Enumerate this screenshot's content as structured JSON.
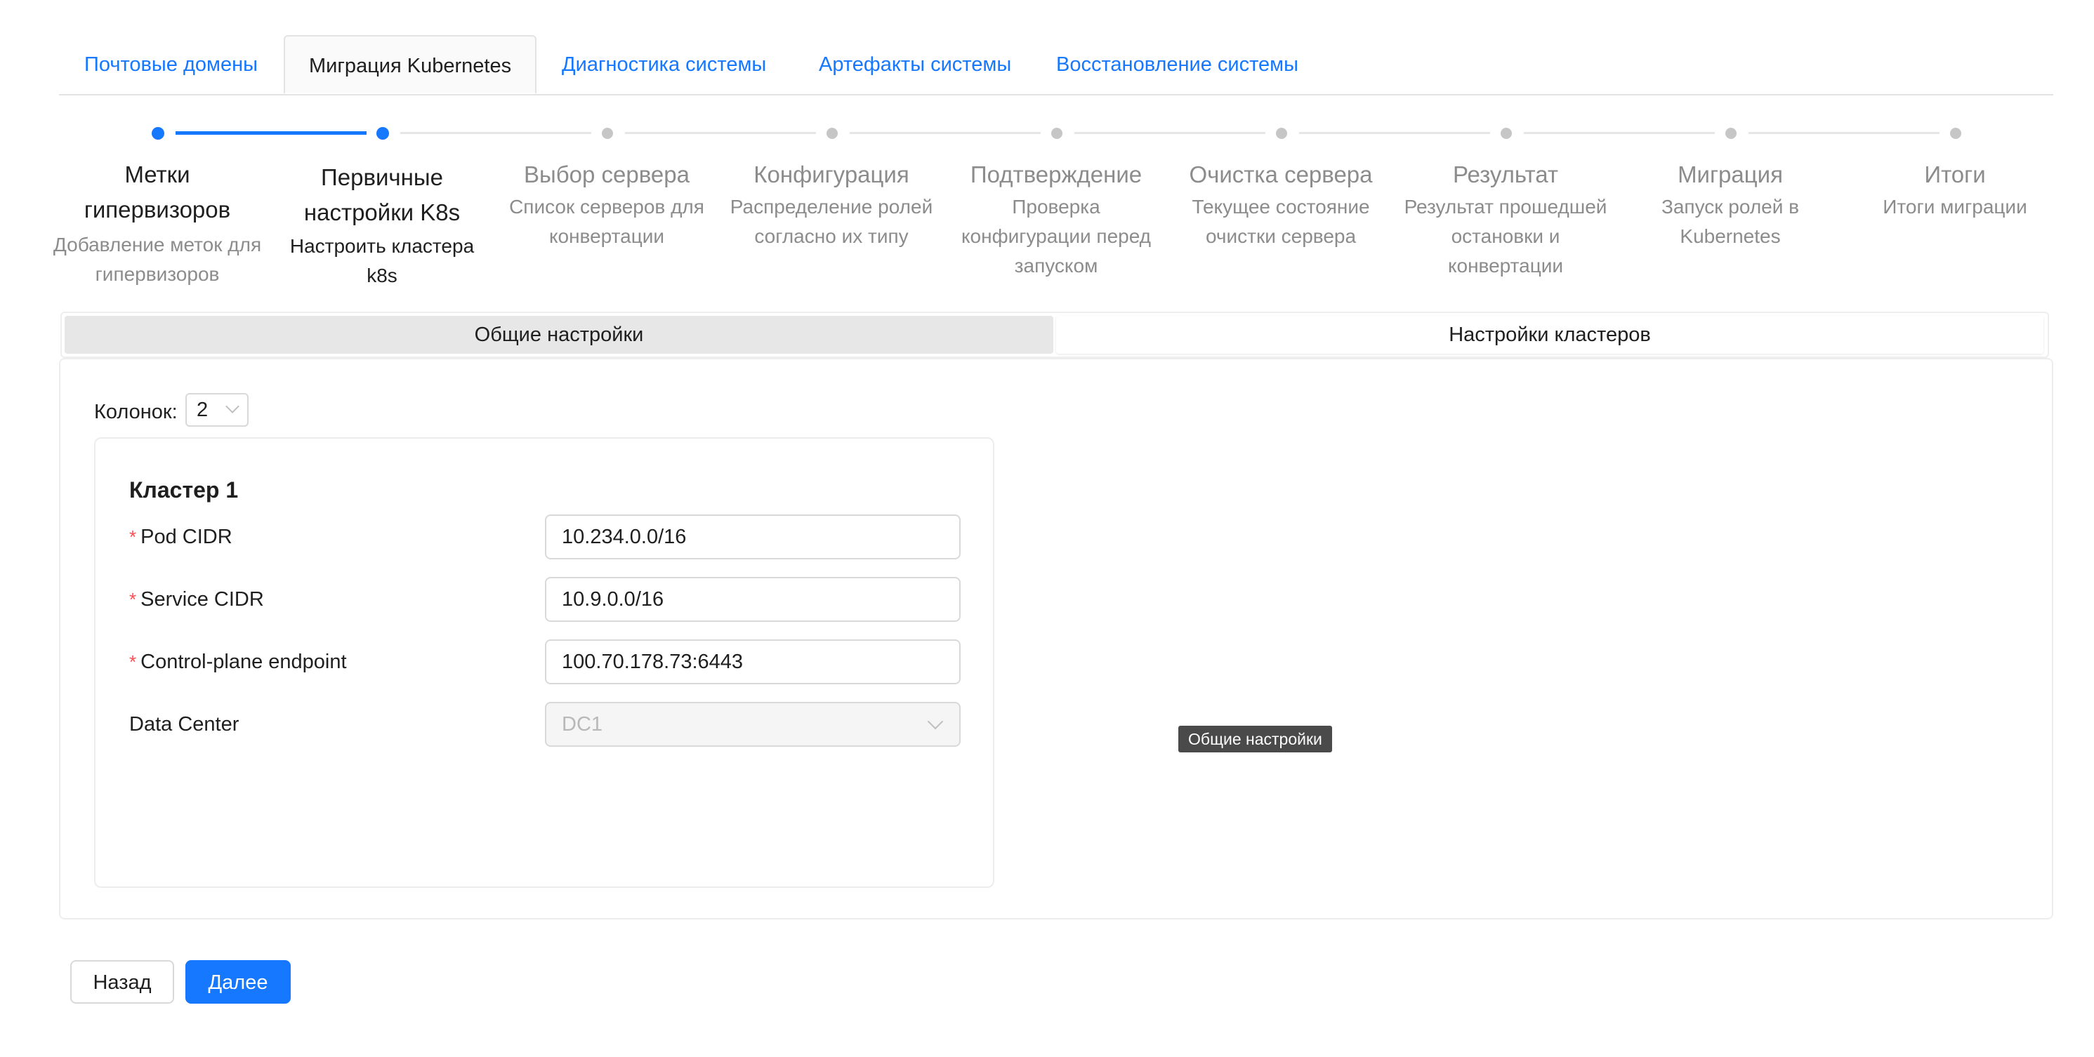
{
  "tabs": [
    {
      "label": "Почтовые домены",
      "active": false
    },
    {
      "label": "Миграция Kubernetes",
      "active": true
    },
    {
      "label": "Диагностика системы",
      "active": false
    },
    {
      "label": "Артефакты системы",
      "active": false
    },
    {
      "label": "Восстановление системы",
      "active": false
    }
  ],
  "steps": [
    {
      "title": "Метки гипервизоров",
      "desc": "Добавление меток для гипервизоров",
      "status": "done"
    },
    {
      "title": "Первичные настройки K8s",
      "desc": "Настроить кластера k8s",
      "status": "current"
    },
    {
      "title": "Выбор сервера",
      "desc": "Список серверов для конвертации",
      "status": "wait"
    },
    {
      "title": "Конфигурация",
      "desc": "Распределение ролей согласно их типу",
      "status": "wait"
    },
    {
      "title": "Подтверждение",
      "desc": "Проверка конфигурации перед запуском",
      "status": "wait"
    },
    {
      "title": "Очистка сервера",
      "desc": "Текущее состояние очистки сервера",
      "status": "wait"
    },
    {
      "title": "Результат",
      "desc": "Результат прошедшей остановки и конвертации",
      "status": "wait"
    },
    {
      "title": "Миграция",
      "desc": "Запуск ролей в Kubernetes",
      "status": "wait"
    },
    {
      "title": "Итоги",
      "desc": "Итоги миграции",
      "status": "wait"
    }
  ],
  "segmented": {
    "general": "Общие настройки",
    "clusters": "Настройки кластеров",
    "selected": "general"
  },
  "columns": {
    "label": "Колонок:",
    "value": "2"
  },
  "cluster": {
    "title": "Кластер 1",
    "fields": [
      {
        "label": "Pod CIDR",
        "required": true,
        "value": "10.234.0.0/16"
      },
      {
        "label": "Service CIDR",
        "required": true,
        "value": "10.9.0.0/16"
      },
      {
        "label": "Control-plane endpoint",
        "required": true,
        "value": "100.70.178.73:6443"
      },
      {
        "label": "Data Center",
        "required": false,
        "value": "DC1"
      }
    ]
  },
  "tooltip": "Общие настройки",
  "buttons": {
    "back": "Назад",
    "next": "Далее"
  },
  "colors": {
    "accent": "#1677ff",
    "required": "#ff4d4f",
    "muted": "#8c8c8c"
  }
}
